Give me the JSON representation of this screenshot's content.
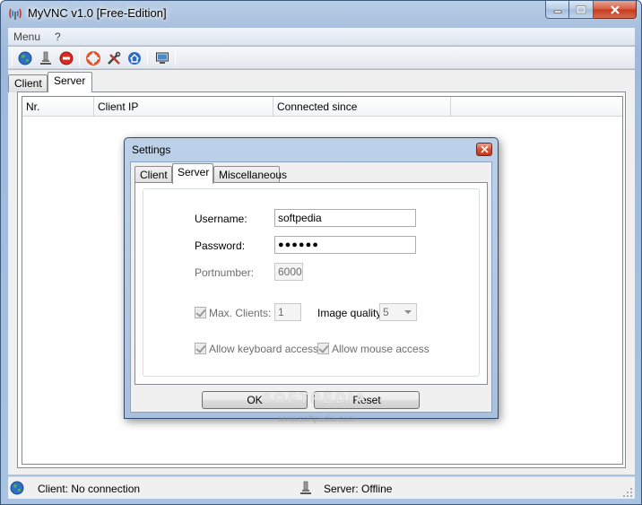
{
  "window": {
    "title": "MyVNC v1.0 [Free-Edition]",
    "icon": "vnc-antenna-icon",
    "caption_buttons": [
      "minimize",
      "maximize",
      "close"
    ]
  },
  "menubar": {
    "items": [
      {
        "label": "Menu"
      },
      {
        "label": "?"
      }
    ]
  },
  "toolbar": {
    "buttons": [
      {
        "icon": "globe-icon"
      },
      {
        "icon": "network-plug-icon"
      },
      {
        "icon": "stop-icon"
      },
      {
        "icon": "lifebuoy-icon"
      },
      {
        "icon": "tools-icon"
      },
      {
        "icon": "home-icon"
      },
      {
        "icon": "monitor-icon"
      }
    ]
  },
  "main_tabs": [
    {
      "label": "Client"
    },
    {
      "label": "Server",
      "active": true
    }
  ],
  "grid": {
    "columns": [
      {
        "label": "Nr."
      },
      {
        "label": "Client IP"
      },
      {
        "label": "Connected since"
      },
      {
        "label": ""
      }
    ],
    "rows": []
  },
  "status": {
    "client": "Client: No connection",
    "server": "Server: Offline"
  },
  "dialog": {
    "title": "Settings",
    "tabs": [
      {
        "label": "Client"
      },
      {
        "label": "Server",
        "active": true
      },
      {
        "label": "Miscellaneous"
      }
    ],
    "username_label": "Username:",
    "username_value": "softpedia",
    "password_label": "Password:",
    "password_value": "●●●●●●",
    "port_label": "Portnumber:",
    "port_value": "6000",
    "max_clients_label": "Max. Clients:",
    "max_clients_value": "1",
    "max_clients_checked": true,
    "image_quality_label": "Image quality:",
    "image_quality_value": "5",
    "keyboard_label": "Allow keyboard access",
    "keyboard_checked": true,
    "mouse_label": "Allow mouse access",
    "mouse_checked": true,
    "ok_label": "OK",
    "reset_label": "Reset"
  },
  "watermark": {
    "text": "SOFTPEDIA",
    "url": "www.softpedia.com"
  },
  "colors": {
    "titlebar": "#a8c0de",
    "close_button": "#c43b1e",
    "panel": "#f0f0f0"
  }
}
